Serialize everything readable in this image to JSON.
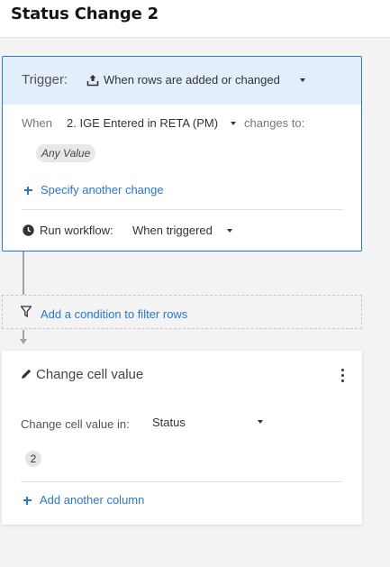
{
  "page": {
    "title": "Status Change 2"
  },
  "trigger": {
    "label": "Trigger:",
    "event": "When rows are added or changed",
    "when_label": "When",
    "column": "2. IGE Entered in RETA (PM)",
    "changes_to_label": "changes to:",
    "value_pill": "Any Value",
    "specify_link": "Specify another change",
    "run_label": "Run workflow:",
    "run_value": "When triggered"
  },
  "filter": {
    "label": "Add a condition to filter rows"
  },
  "action": {
    "title": "Change cell value",
    "field_label": "Change cell value in:",
    "field_value": "Status",
    "value": "2",
    "add_column_link": "Add another column"
  },
  "colors": {
    "accent": "#2b78c5",
    "trigger_header_bg": "#e2eefb",
    "canvas_bg": "#f3f3f3"
  },
  "icons": {
    "trigger": "upload-tray-icon",
    "clock": "clock-icon",
    "filter": "filter-icon",
    "edit": "pencil-icon",
    "menu": "more-vertical-icon",
    "add": "plus-icon",
    "dropdown": "caret-down-icon"
  }
}
